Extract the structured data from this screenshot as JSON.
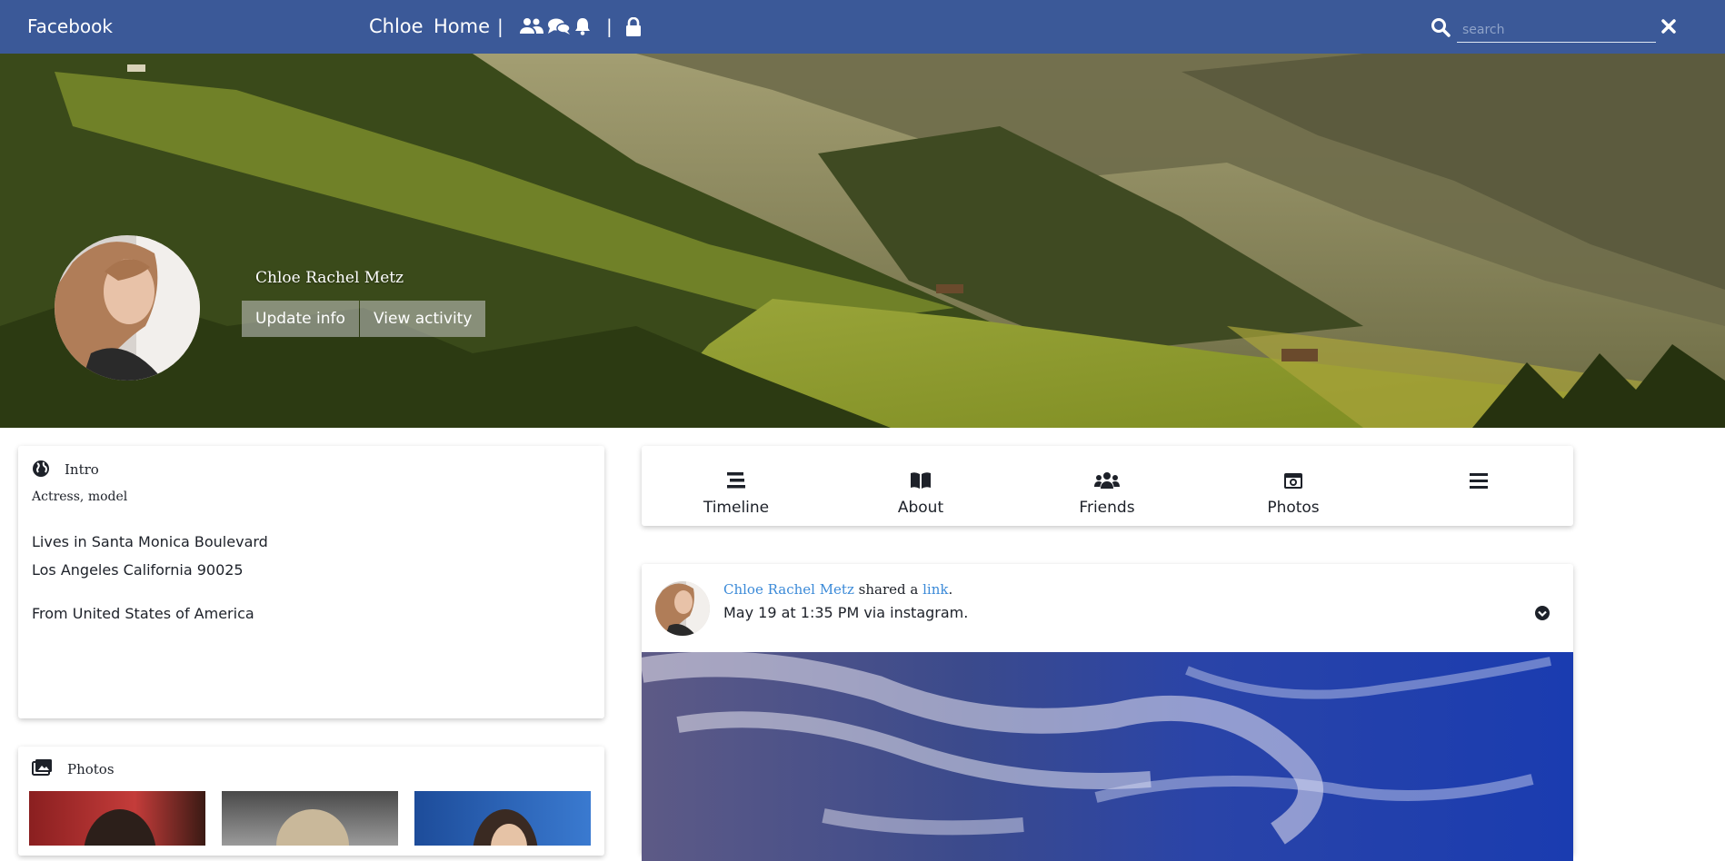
{
  "topbar": {
    "brand": "Facebook",
    "nav": [
      "Chloe",
      "Home"
    ],
    "separator": "|",
    "icons": [
      "friends-icon",
      "messages-icon",
      "notifications-icon",
      "privacy-lock-icon"
    ],
    "search_placeholder": "search",
    "search_value": "",
    "close_icon": "close-icon",
    "color": "#3b5998"
  },
  "profile": {
    "name": "Chloe Rachel Metz",
    "buttons": [
      "Update info",
      "View activity"
    ]
  },
  "intro": {
    "title": "Intro",
    "icon": "globe-icon",
    "occupation": "Actress, model",
    "lives_line1": "Lives in Santa Monica Boulevard",
    "lives_line2": "Los Angeles California 90025",
    "from": "From United States of America"
  },
  "photos": {
    "title": "Photos",
    "icon": "photos-icon"
  },
  "tabs": [
    {
      "label": "Timeline",
      "icon": "timeline-icon"
    },
    {
      "label": "About",
      "icon": "book-icon"
    },
    {
      "label": "Friends",
      "icon": "friends-icon"
    },
    {
      "label": "Photos",
      "icon": "camera-icon"
    },
    {
      "label": "",
      "icon": "menu-icon"
    }
  ],
  "post": {
    "author": "Chloe Rachel Metz",
    "action": "shared a",
    "object": "link",
    "meta": "May 19 at 1:35 PM via instagram.",
    "menu_icon": "chevron-down-circle-icon",
    "link_color": "#3b8ad8"
  }
}
